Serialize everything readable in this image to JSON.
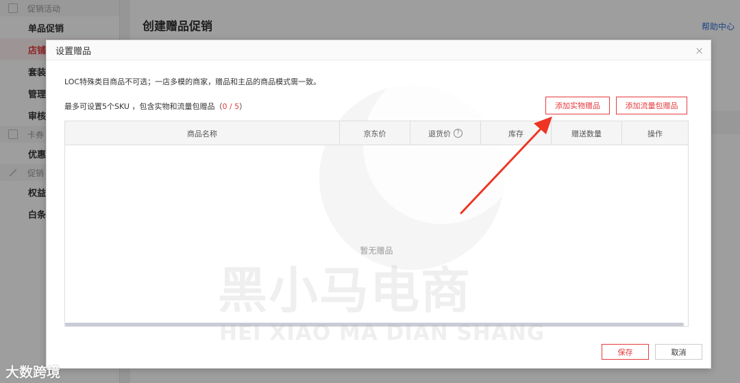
{
  "sidebar": {
    "group1": "促销活动",
    "items1": [
      "单品促销",
      "店铺",
      "套装",
      "管理",
      "审核"
    ],
    "group2": "卡券",
    "items2": [
      "优惠"
    ],
    "group3": "促销",
    "items3": [
      "权益",
      "白条"
    ]
  },
  "main": {
    "title": "创建赠品促销",
    "help": "帮助中心"
  },
  "modal": {
    "title": "设置赠品",
    "close": "×",
    "notice": "LOC特殊类目商品不可选；一店多模的商家，赠品和主品的商品模式需一致。",
    "limit_text": "最多可设置5个SKU ，包含实物和流量包赠品（",
    "limit_count": "0 / 5",
    "limit_end": "）",
    "btn_add_physical": "添加实物赠品",
    "btn_add_data": "添加流量包赠品",
    "columns": [
      "商品名称",
      "京东价",
      "退货价",
      "库存",
      "赠送数量",
      "操作"
    ],
    "help_icon_glyph": "?",
    "empty": "暂无赠品",
    "btn_save": "保存",
    "btn_cancel": "取消"
  },
  "watermark": {
    "cn": "黑小马电商",
    "en": "HEI XIAO MA DIAN SHANG",
    "corner": "大数跨境"
  },
  "colors": {
    "accent": "#e4393c",
    "link": "#2d6fd6",
    "arrow": "#ee3524"
  },
  "icons": [
    "promo-icon",
    "card-icon",
    "pencil-icon",
    "close-icon",
    "help-circle-icon",
    "arrow-annotation"
  ]
}
